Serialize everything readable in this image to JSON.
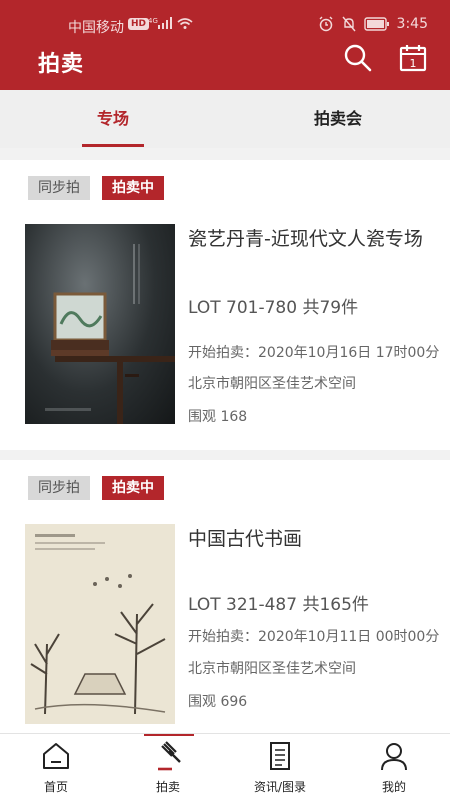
{
  "status_bar": {
    "carrier": "中国移动",
    "network_badge": "HD",
    "time": "3:45"
  },
  "header": {
    "title": "拍卖",
    "icons": [
      "search-icon",
      "calendar-icon"
    ],
    "calendar_day": "1"
  },
  "tabs": [
    {
      "label": "专场",
      "active": true
    },
    {
      "label": "拍卖会",
      "active": false
    }
  ],
  "auctions": [
    {
      "tags": [
        "同步拍",
        "拍卖中"
      ],
      "name": "瓷艺丹青-近现代文人瓷专场",
      "lot": "LOT 701-780 共79件",
      "start_time": "开始拍卖：2020年10月16日 17时00分",
      "location": "北京市朝阳区圣佳艺术空间",
      "views": "围观 168"
    },
    {
      "tags": [
        "同步拍",
        "拍卖中"
      ],
      "name": "中国古代书画",
      "lot": "LOT 321-487 共165件",
      "start_time": "开始拍卖：2020年10月11日 00时00分",
      "location": "北京市朝阳区圣佳艺术空间",
      "views": "围观 696"
    }
  ],
  "bottom_nav": [
    {
      "label": "首页",
      "icon": "home-icon"
    },
    {
      "label": "拍卖",
      "icon": "gavel-icon",
      "active": true
    },
    {
      "label": "资讯/图录",
      "icon": "document-icon"
    },
    {
      "label": "我的",
      "icon": "user-icon"
    }
  ],
  "colors": {
    "brand": "#b3262b",
    "background": "#f2f2f2"
  }
}
